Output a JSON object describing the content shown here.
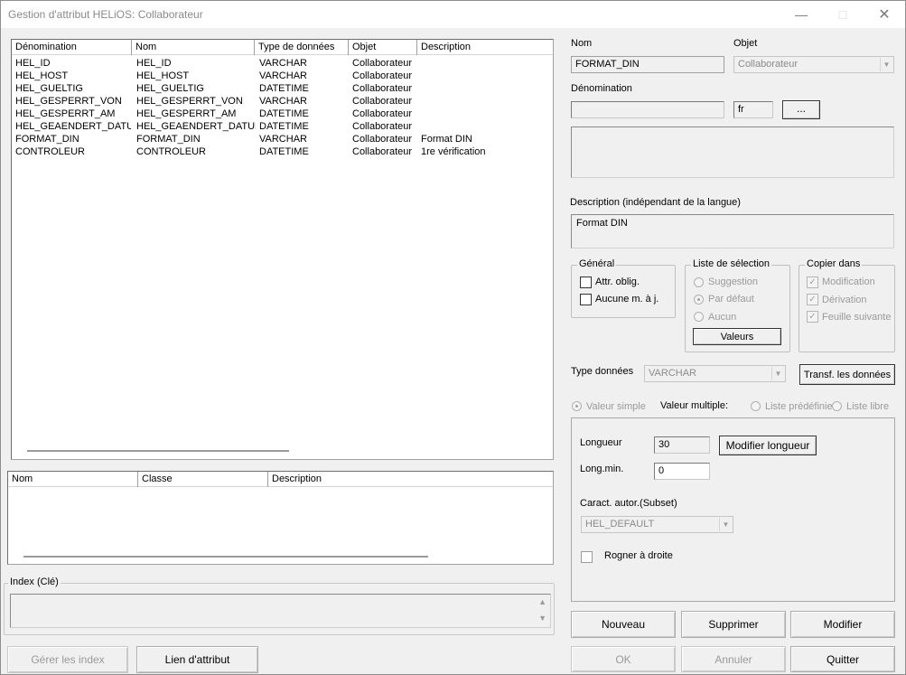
{
  "window": {
    "title": "Gestion d'attribut HELiOS: Collaborateur"
  },
  "attr_list": {
    "columns": [
      "Dénomination",
      "Nom",
      "Type de données",
      "Objet",
      "Description"
    ],
    "rows": [
      [
        "HEL_ID",
        "HEL_ID",
        "VARCHAR",
        "Collaborateur",
        ""
      ],
      [
        "HEL_HOST",
        "HEL_HOST",
        "VARCHAR",
        "Collaborateur",
        ""
      ],
      [
        "HEL_GUELTIG",
        "HEL_GUELTIG",
        "DATETIME",
        "Collaborateur",
        ""
      ],
      [
        "HEL_GESPERRT_VON",
        "HEL_GESPERRT_VON",
        "VARCHAR",
        "Collaborateur",
        ""
      ],
      [
        "HEL_GESPERRT_AM",
        "HEL_GESPERRT_AM",
        "DATETIME",
        "Collaborateur",
        ""
      ],
      [
        "HEL_GEAENDERT_DATUM",
        "HEL_GEAENDERT_DATUM",
        "DATETIME",
        "Collaborateur",
        ""
      ],
      [
        "FORMAT_DIN",
        "FORMAT_DIN",
        "VARCHAR",
        "Collaborateur",
        "Format DIN"
      ],
      [
        "CONTROLEUR",
        "CONTROLEUR",
        "DATETIME",
        "Collaborateur",
        "1re vérification"
      ]
    ]
  },
  "class_list": {
    "columns": [
      "Nom",
      "Classe",
      "Description"
    ]
  },
  "index": {
    "label": "Index (Clé)"
  },
  "bottom_left": {
    "manage_index": "Gérer les index",
    "attr_link": "Lien d'attribut"
  },
  "form": {
    "nom_label": "Nom",
    "nom_value": "FORMAT_DIN",
    "objet_label": "Objet",
    "objet_value": "Collaborateur",
    "denomination_label": "Dénomination",
    "denomination_value": "",
    "lang_value": "fr",
    "browse_label": "...",
    "description_label": "Description (indépendant de la langue)",
    "description_value": "Format DIN"
  },
  "general": {
    "title": "Général",
    "mandatory": "Attr. oblig.",
    "no_update": "Aucune m. à j."
  },
  "selection": {
    "title": "Liste de sélection",
    "suggestion": "Suggestion",
    "default": "Par défaut",
    "none": "Aucun",
    "values_btn": "Valeurs"
  },
  "copy": {
    "title": "Copier dans",
    "modification": "Modification",
    "derivation": "Dérivation",
    "next_sheet": "Feuille suivante"
  },
  "datatype": {
    "label": "Type données",
    "value": "VARCHAR",
    "transform_btn": "Transf. les données"
  },
  "value_mode": {
    "simple": "Valeur simple",
    "multiple_label": "Valeur multiple:",
    "predefined": "Liste prédéfinie",
    "free": "Liste libre"
  },
  "length": {
    "length_label": "Longueur",
    "length_value": "30",
    "modify_btn": "Modifier longueur",
    "min_label": "Long.min.",
    "min_value": "0",
    "subset_label": "Caract. autor.(Subset)",
    "subset_value": "HEL_DEFAULT",
    "trim_right": "Rogner à droite"
  },
  "actions": {
    "new": "Nouveau",
    "delete": "Supprimer",
    "modify": "Modifier",
    "ok": "OK",
    "cancel": "Annuler",
    "quit": "Quitter"
  },
  "colors": {
    "window_bg": "#f0f0f0",
    "disabled_text": "#9a9a9a"
  }
}
